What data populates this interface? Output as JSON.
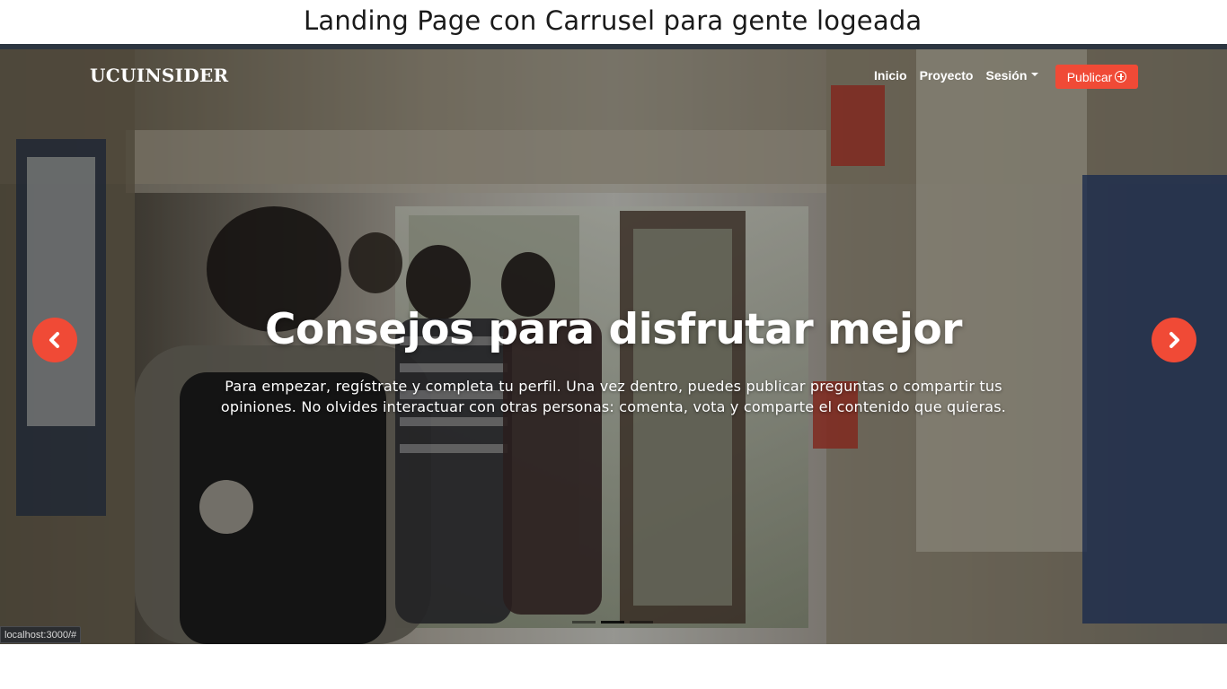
{
  "caption": "Landing Page con Carrusel para gente logeada",
  "navbar": {
    "brand": "UCUINSIDER",
    "links": [
      {
        "label": "Inicio"
      },
      {
        "label": "Proyecto"
      },
      {
        "label": "Sesión"
      }
    ],
    "publish_label": "Publicar",
    "publish_icon": "plus-circle-icon",
    "accent_color": "#f04a36"
  },
  "carousel": {
    "title": "Consejos para disfrutar mejor",
    "text": "Para empezar, regístrate y completa tu perfil. Una vez dentro, puedes publicar preguntas o compartir tus opiniones. No olvides interactuar con otras personas: comenta, vota y comparte el contenido que quieras.",
    "prev_icon": "chevron-left-icon",
    "next_icon": "chevron-right-icon",
    "indicator_count": 3,
    "active_indicator": 2
  },
  "status_bar": {
    "url": "localhost:3000/#"
  }
}
